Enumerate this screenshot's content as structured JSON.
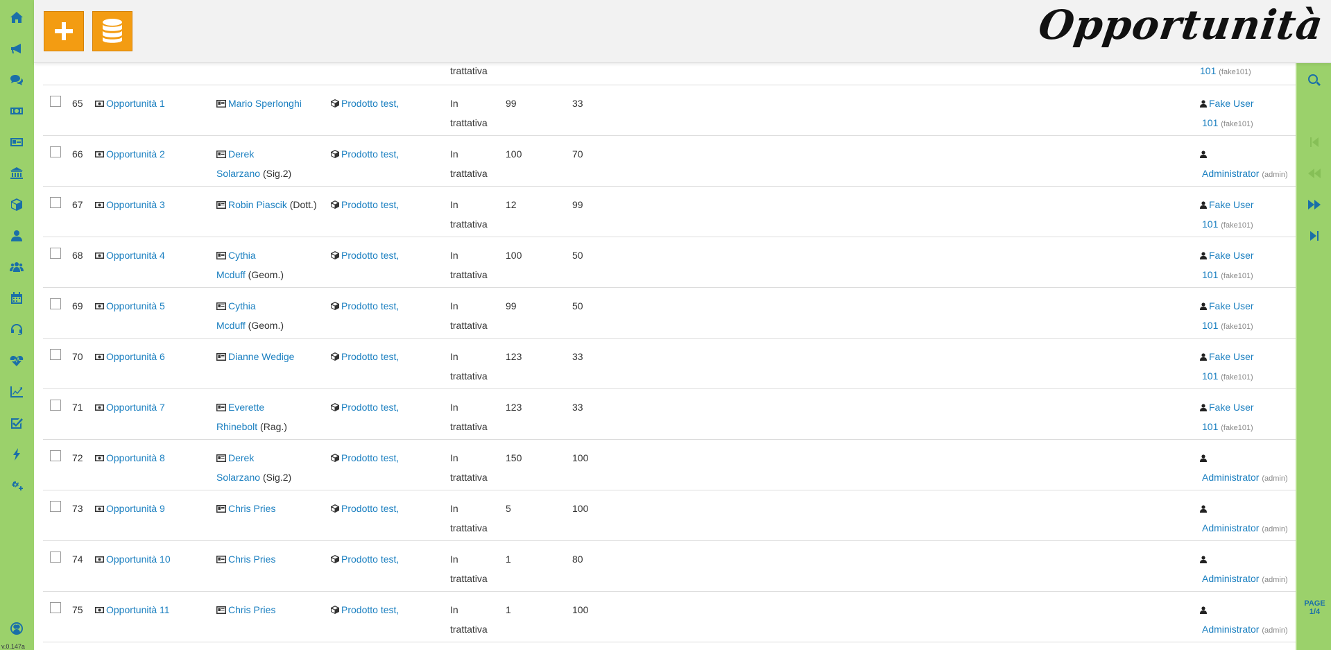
{
  "app": {
    "title": "Opportunità",
    "version": "v.0.147a"
  },
  "header": {
    "add_button_icon": "plus-icon",
    "database_button_icon": "database-icon"
  },
  "left_sidebar": {
    "icons": [
      "home-icon",
      "bullhorn-icon",
      "comments-icon",
      "money-icon",
      "address-card-icon",
      "bank-icon",
      "cube-icon",
      "user-icon",
      "users-icon",
      "calendar-icon",
      "headset-icon",
      "heartbeat-icon",
      "line-chart-icon",
      "check-square-icon",
      "bolt-icon",
      "cogs-icon",
      "user-circle-icon"
    ]
  },
  "right_sidebar": {
    "icons": [
      "search-icon",
      "first-page-icon",
      "previous-page-icon",
      "next-page-icon",
      "last-page-icon"
    ],
    "page_label": "PAGE",
    "page_value": "1/4"
  },
  "partial_row": {
    "status_line2": "trattativa",
    "owner_line2": "101",
    "owner_username": "(fake101)"
  },
  "rows": [
    {
      "num": "65",
      "name": "Opportunità 1",
      "contact": "Mario Sperlonghi",
      "contact_line2": "",
      "title": "",
      "product": "Prodotto test,",
      "status1": "In",
      "status2": "trattativa",
      "v1": "99",
      "v2": "33",
      "owner1": "Fake User",
      "owner2": "101",
      "owner_user": "(fake101)"
    },
    {
      "num": "66",
      "name": "Opportunità 2",
      "contact": "Derek",
      "contact_line2": "Solarzano",
      "title": "(Sig.2)",
      "product": "Prodotto test,",
      "status1": "In",
      "status2": "trattativa",
      "v1": "100",
      "v2": "70",
      "owner1": "",
      "owner2": "Administrator",
      "owner_user": "(admin)"
    },
    {
      "num": "67",
      "name": "Opportunità 3",
      "contact": "Robin Piascik",
      "contact_line2": "",
      "title": "(Dott.)",
      "product": "Prodotto test,",
      "status1": "In",
      "status2": "trattativa",
      "v1": "12",
      "v2": "99",
      "owner1": "Fake User",
      "owner2": "101",
      "owner_user": "(fake101)"
    },
    {
      "num": "68",
      "name": "Opportunità 4",
      "contact": "Cythia",
      "contact_line2": "Mcduff",
      "title": "(Geom.)",
      "product": "Prodotto test,",
      "status1": "In",
      "status2": "trattativa",
      "v1": "100",
      "v2": "50",
      "owner1": "Fake User",
      "owner2": "101",
      "owner_user": "(fake101)"
    },
    {
      "num": "69",
      "name": "Opportunità 5",
      "contact": "Cythia",
      "contact_line2": "Mcduff",
      "title": "(Geom.)",
      "product": "Prodotto test,",
      "status1": "In",
      "status2": "trattativa",
      "v1": "99",
      "v2": "50",
      "owner1": "Fake User",
      "owner2": "101",
      "owner_user": "(fake101)"
    },
    {
      "num": "70",
      "name": "Opportunità 6",
      "contact": "Dianne Wedige",
      "contact_line2": "",
      "title": "",
      "product": "Prodotto test,",
      "status1": "In",
      "status2": "trattativa",
      "v1": "123",
      "v2": "33",
      "owner1": "Fake User",
      "owner2": "101",
      "owner_user": "(fake101)"
    },
    {
      "num": "71",
      "name": "Opportunità 7",
      "contact": "Everette",
      "contact_line2": "Rhinebolt",
      "title": "(Rag.)",
      "product": "Prodotto test,",
      "status1": "In",
      "status2": "trattativa",
      "v1": "123",
      "v2": "33",
      "owner1": "Fake User",
      "owner2": "101",
      "owner_user": "(fake101)"
    },
    {
      "num": "72",
      "name": "Opportunità 8",
      "contact": "Derek",
      "contact_line2": "Solarzano",
      "title": "(Sig.2)",
      "product": "Prodotto test,",
      "status1": "In",
      "status2": "trattativa",
      "v1": "150",
      "v2": "100",
      "owner1": "",
      "owner2": "Administrator",
      "owner_user": "(admin)"
    },
    {
      "num": "73",
      "name": "Opportunità 9",
      "contact": "Chris Pries",
      "contact_line2": "",
      "title": "",
      "product": "Prodotto test,",
      "status1": "In",
      "status2": "trattativa",
      "v1": "5",
      "v2": "100",
      "owner1": "",
      "owner2": "Administrator",
      "owner_user": "(admin)"
    },
    {
      "num": "74",
      "name": "Opportunità 10",
      "contact": "Chris Pries",
      "contact_line2": "",
      "title": "",
      "product": "Prodotto test,",
      "status1": "In",
      "status2": "trattativa",
      "v1": "1",
      "v2": "80",
      "owner1": "",
      "owner2": "Administrator",
      "owner_user": "(admin)"
    },
    {
      "num": "75",
      "name": "Opportunità 11",
      "contact": "Chris Pries",
      "contact_line2": "",
      "title": "",
      "product": "Prodotto test,",
      "status1": "In",
      "status2": "trattativa",
      "v1": "1",
      "v2": "100",
      "owner1": "",
      "owner2": "Administrator",
      "owner_user": "(admin)"
    }
  ]
}
